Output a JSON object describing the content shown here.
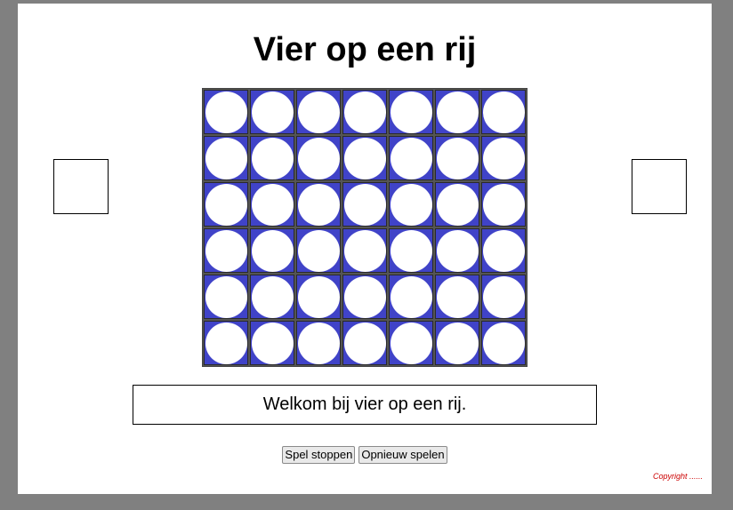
{
  "page": {
    "title": "Vier op een rij",
    "message": "Welkom bij vier op een rij.",
    "copyright": "Copyright ......"
  },
  "board": {
    "rows": 6,
    "columns": 7,
    "cells": [
      [
        "empty",
        "empty",
        "empty",
        "empty",
        "empty",
        "empty",
        "empty"
      ],
      [
        "empty",
        "empty",
        "empty",
        "empty",
        "empty",
        "empty",
        "empty"
      ],
      [
        "empty",
        "empty",
        "empty",
        "empty",
        "empty",
        "empty",
        "empty"
      ],
      [
        "empty",
        "empty",
        "empty",
        "empty",
        "empty",
        "empty",
        "empty"
      ],
      [
        "empty",
        "empty",
        "empty",
        "empty",
        "empty",
        "empty",
        "empty"
      ],
      [
        "empty",
        "empty",
        "empty",
        "empty",
        "empty",
        "empty",
        "empty"
      ]
    ],
    "board_color": "#4043c8",
    "empty_color": "#ffffff"
  },
  "controls": {
    "stop_label": "Spel stoppen",
    "restart_label": "Opnieuw spelen"
  },
  "colors": {
    "background": "#808080",
    "copyright": "#cc0000"
  }
}
